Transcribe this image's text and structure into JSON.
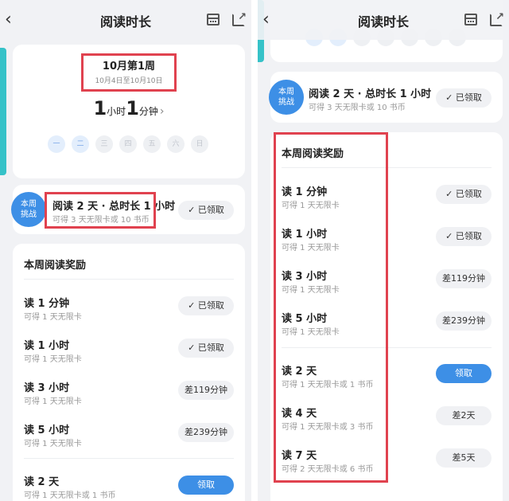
{
  "header": {
    "title": "阅读时长",
    "back_icon": "‹"
  },
  "week": {
    "title": "10月第1周",
    "range": "10月4日至10月10日",
    "hours_value": "1",
    "hours_unit": "小时",
    "minutes_value": "1",
    "minutes_unit": "分钟",
    "chevron": "›",
    "days": [
      "一",
      "二",
      "三",
      "四",
      "五",
      "六",
      "日"
    ]
  },
  "challenge": {
    "badge_line1": "本周",
    "badge_line2": "挑战",
    "title": "阅读 2 天 · 总时长 1 小时",
    "subtitle": "可得 3 天无限卡或 10 书币",
    "status": "✓ 已领取"
  },
  "rewards": {
    "title": "本周阅读奖励",
    "time_items": [
      {
        "title": "读 1 分钟",
        "sub": "可得 1 天无限卡",
        "action": "✓ 已领取"
      },
      {
        "title": "读 1 小时",
        "sub": "可得 1 天无限卡",
        "action": "✓ 已领取"
      },
      {
        "title": "读 3 小时",
        "sub": "可得 1 天无限卡",
        "action": "差119分钟"
      },
      {
        "title": "读 5 小时",
        "sub": "可得 1 天无限卡",
        "action": "差239分钟"
      }
    ],
    "day_items": [
      {
        "title": "读 2 天",
        "sub": "可得 1 天无限卡或 1 书币",
        "action": "领取"
      },
      {
        "title": "读 4 天",
        "sub": "可得 1 天无限卡或 3 书币",
        "action": "差2天"
      },
      {
        "title": "读 7 天",
        "sub": "可得 2 天无限卡或 6 书币",
        "action": "差5天"
      }
    ]
  },
  "colors": {
    "accent": "#3d8fe6",
    "highlight": "#e0424f",
    "teal": "#36c2c8"
  }
}
